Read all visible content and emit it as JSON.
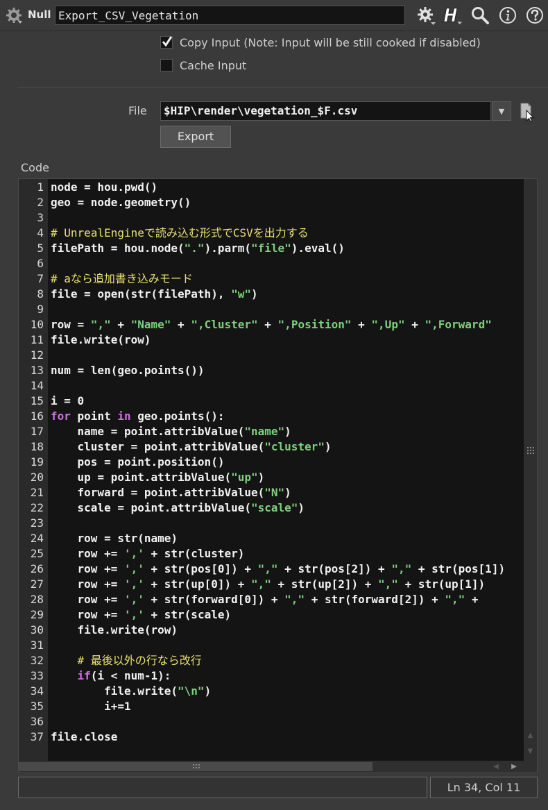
{
  "header": {
    "node_type": "Null",
    "node_name": "Export_CSV_Vegetation",
    "icons": [
      "gear-icon",
      "help-h-icon",
      "search-icon",
      "info-icon",
      "question-icon"
    ]
  },
  "params": {
    "copy_input_label": "Copy Input (Note: Input will be still cooked if disabled)",
    "copy_input_checked": true,
    "cache_input_label": "Cache Input",
    "cache_input_checked": false,
    "file_label": "File",
    "file_value": "$HIP\\render\\vegetation_$F.csv",
    "export_label": "Export",
    "code_label": "Code"
  },
  "code": {
    "line_numbers": [
      "1",
      "2",
      "3",
      "4",
      "5",
      "6",
      "7",
      "8",
      "9",
      "10",
      "11",
      "12",
      "13",
      "14",
      "15",
      "16",
      "17",
      "18",
      "19",
      "20",
      "21",
      "22",
      "23",
      "24",
      "25",
      "26",
      "27",
      "28",
      "29",
      "30",
      "31",
      "32",
      "33",
      "34",
      "35",
      "36",
      "37"
    ],
    "lines": [
      [
        [
          "node = hou.pwd()",
          ""
        ]
      ],
      [
        [
          "geo = node.geometry()",
          ""
        ]
      ],
      [],
      [
        [
          "# UnrealEngineで読み込む形式でCSVを出力する",
          "cm"
        ]
      ],
      [
        [
          "filePath = hou.node(",
          ""
        ],
        [
          "\".\"",
          "s"
        ],
        [
          ").parm(",
          ""
        ],
        [
          "\"file\"",
          "s"
        ],
        [
          ").eval()",
          ""
        ]
      ],
      [],
      [
        [
          "# aなら追加書き込みモード",
          "cm"
        ]
      ],
      [
        [
          "file = open(str(filePath), ",
          ""
        ],
        [
          "\"w\"",
          "s"
        ],
        [
          ")",
          ""
        ]
      ],
      [],
      [
        [
          "row = ",
          ""
        ],
        [
          "\",\"",
          "s"
        ],
        [
          " + ",
          ""
        ],
        [
          "\"Name\"",
          "s"
        ],
        [
          " + ",
          ""
        ],
        [
          "\",Cluster\"",
          "s"
        ],
        [
          " + ",
          ""
        ],
        [
          "\",Position\"",
          "s"
        ],
        [
          " + ",
          ""
        ],
        [
          "\",Up\"",
          "s"
        ],
        [
          " + ",
          ""
        ],
        [
          "\",Forward\"",
          "s"
        ]
      ],
      [
        [
          "file.write(row)",
          ""
        ]
      ],
      [],
      [
        [
          "num = len(geo.points())",
          ""
        ]
      ],
      [],
      [
        [
          "i = 0",
          ""
        ]
      ],
      [
        [
          "for",
          "kw"
        ],
        [
          " point ",
          ""
        ],
        [
          "in",
          "kw"
        ],
        [
          " geo.points():",
          ""
        ]
      ],
      [
        [
          "    name = point.attribValue(",
          ""
        ],
        [
          "\"name\"",
          "s"
        ],
        [
          ")",
          ""
        ]
      ],
      [
        [
          "    cluster = point.attribValue(",
          ""
        ],
        [
          "\"cluster\"",
          "s"
        ],
        [
          ")",
          ""
        ]
      ],
      [
        [
          "    pos = point.position()",
          ""
        ]
      ],
      [
        [
          "    up = point.attribValue(",
          ""
        ],
        [
          "\"up\"",
          "s"
        ],
        [
          ")",
          ""
        ]
      ],
      [
        [
          "    forward = point.attribValue(",
          ""
        ],
        [
          "\"N\"",
          "s"
        ],
        [
          ")",
          ""
        ]
      ],
      [
        [
          "    scale = point.attribValue(",
          ""
        ],
        [
          "\"scale\"",
          "s"
        ],
        [
          ")",
          ""
        ]
      ],
      [],
      [
        [
          "    row = str(name)",
          ""
        ]
      ],
      [
        [
          "    row += ",
          ""
        ],
        [
          "','",
          "s"
        ],
        [
          " + str(cluster)",
          ""
        ]
      ],
      [
        [
          "    row += ",
          ""
        ],
        [
          "','",
          "s"
        ],
        [
          " + str(pos[0]) + ",
          ""
        ],
        [
          "\",\"",
          "s"
        ],
        [
          " + str(pos[2]) + ",
          ""
        ],
        [
          "\",\"",
          "s"
        ],
        [
          " + str(pos[1])",
          ""
        ]
      ],
      [
        [
          "    row += ",
          ""
        ],
        [
          "','",
          "s"
        ],
        [
          " + str(up[0]) + ",
          ""
        ],
        [
          "\",\"",
          "s"
        ],
        [
          " + str(up[2]) + ",
          ""
        ],
        [
          "\",\"",
          "s"
        ],
        [
          " + str(up[1])",
          ""
        ]
      ],
      [
        [
          "    row += ",
          ""
        ],
        [
          "','",
          "s"
        ],
        [
          " + str(forward[0]) + ",
          ""
        ],
        [
          "\",\"",
          "s"
        ],
        [
          " + str(forward[2]) + ",
          ""
        ],
        [
          "\",\"",
          "s"
        ],
        [
          " + ",
          ""
        ]
      ],
      [
        [
          "    row += ",
          ""
        ],
        [
          "','",
          "s"
        ],
        [
          " + str(scale)",
          ""
        ]
      ],
      [
        [
          "    file.write(row)",
          ""
        ]
      ],
      [],
      [
        [
          "    # 最後以外の行なら改行",
          "cm"
        ]
      ],
      [
        [
          "    ",
          ""
        ],
        [
          "if",
          "kw"
        ],
        [
          "(i < num-1):",
          ""
        ]
      ],
      [
        [
          "        file.write(",
          ""
        ],
        [
          "\"\\n\"",
          "s"
        ],
        [
          ")",
          ""
        ]
      ],
      [
        [
          "        i+=1",
          ""
        ]
      ],
      [],
      [
        [
          "file.close",
          ""
        ]
      ]
    ]
  },
  "status": {
    "cursor_position": "Ln 34, Col 11"
  }
}
